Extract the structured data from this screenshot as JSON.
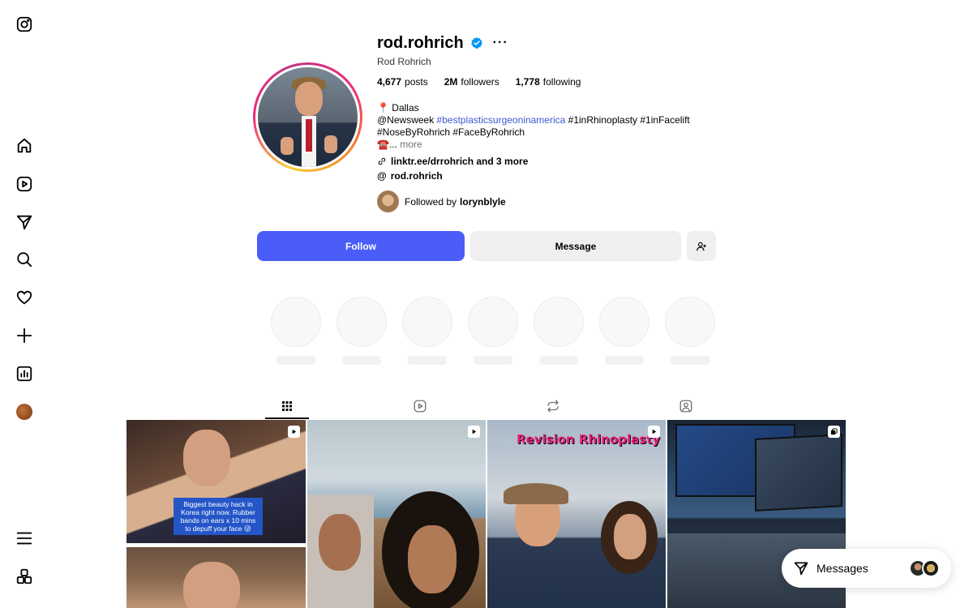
{
  "profile": {
    "username": "rod.rohrich",
    "full_name": "Rod Rohrich",
    "stats": {
      "posts_count": "4,677",
      "posts_label": "posts",
      "followers_count": "2M",
      "followers_label": "followers",
      "following_count": "1,778",
      "following_label": "following"
    },
    "bio": {
      "location": "📍 Dallas",
      "line2_mention": "@Newsweek",
      "line2_tag": "#bestplasticsurgeoninamerica",
      "line2_rest": "#1inRhinoplasty #1inFacelift",
      "line3": "#NoseByRohrich #FaceByRohrich",
      "line4_emoji": "☎️...",
      "more": "more"
    },
    "link_text": "linktr.ee/drrohrich and 3 more",
    "threads_handle": "rod.rohrich",
    "followed_by_prefix": "Followed by",
    "followed_by_user": "lorynblyle"
  },
  "buttons": {
    "follow": "Follow",
    "message": "Message"
  },
  "posts": {
    "tile1_caption": "Biggest beauty hack in Korea right now. Rubber bands on ears x 10 mins to depuff your face 😜",
    "tile3_title": "Revision Rhinoplasty"
  },
  "messages_pill": {
    "label": "Messages"
  },
  "colors": {
    "follow_button": "#4a5df9",
    "verified_badge": "#0095f6",
    "hashtag_link": "#3d5ad1"
  }
}
